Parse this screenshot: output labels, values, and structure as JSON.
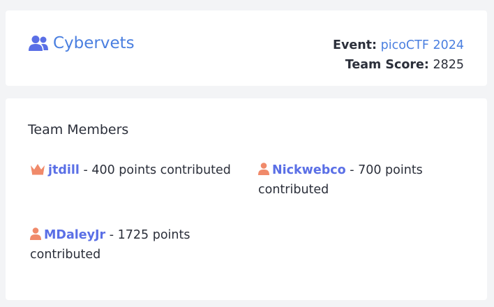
{
  "team": {
    "name": "Cybervets",
    "icon": "users-icon"
  },
  "event": {
    "label": "Event:",
    "name": "picoCTF 2024"
  },
  "score": {
    "label": "Team Score:",
    "value": "2825"
  },
  "members_section": {
    "title": "Team Members",
    "members": [
      {
        "name": "jtdill",
        "detail": "- 400 points contributed",
        "icon": "crown-icon"
      },
      {
        "name": "Nickwebco",
        "detail": "- 700 points contributed",
        "icon": "user-icon"
      },
      {
        "name": "MDaleyJr",
        "detail": "- 1725 points contributed",
        "icon": "user-icon"
      }
    ]
  },
  "colors": {
    "link": "#4a7fe0",
    "member_name": "#5a6fe6",
    "icon_orange": "#f08a6a",
    "background": "#f3f4f6"
  }
}
